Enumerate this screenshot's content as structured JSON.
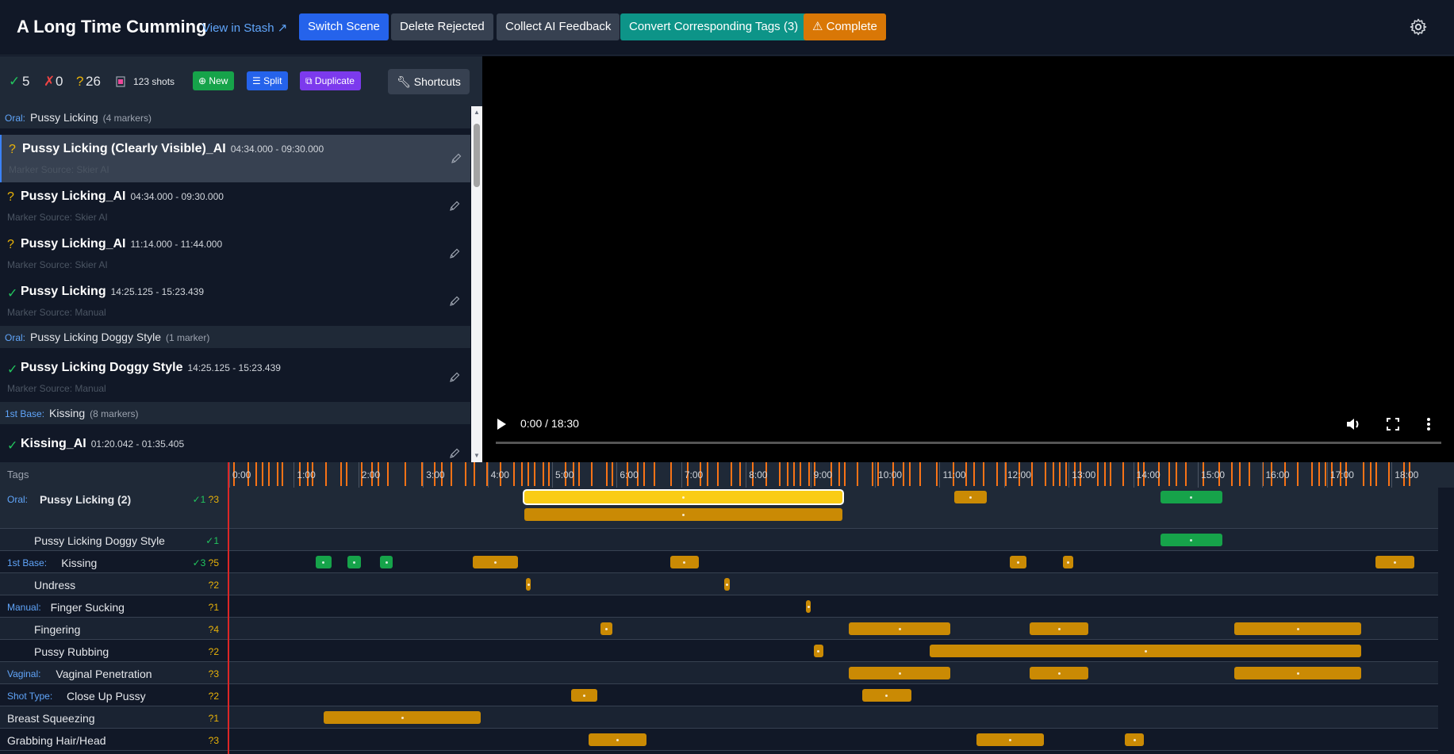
{
  "header": {
    "title": "A Long Time Cumming",
    "view_link": "View in Stash ↗",
    "buttons": {
      "switch_scene": "Switch Scene",
      "delete_rejected": "Delete Rejected",
      "collect_feedback": "Collect AI Feedback",
      "convert_tags": "Convert Corresponding Tags (3)",
      "complete": "Complete"
    },
    "colors": {
      "primary": "#2563eb",
      "secondary": "#374151",
      "teal": "#0d9488",
      "warning": "#d97706"
    }
  },
  "stats": {
    "confirmed_icon": "✓",
    "confirmed": "5",
    "rejected_icon": "✗",
    "rejected": "0",
    "pending_icon": "?",
    "pending": "26",
    "shots": "123 shots",
    "new_label": "New",
    "split_label": "Split",
    "duplicate_label": "Duplicate",
    "shortcuts_label": "Shortcuts"
  },
  "marker_list": {
    "groups": [
      {
        "category": "Oral:",
        "tag": "Pussy Licking",
        "count": "(4 markers)"
      },
      {
        "category": "Oral:",
        "tag": "Pussy Licking Doggy Style",
        "count": "(1 marker)"
      },
      {
        "category": "1st Base:",
        "tag": "Kissing",
        "count": "(8 markers)"
      }
    ],
    "markers": [
      {
        "status": "?",
        "status_type": "pending",
        "name": "Pussy Licking (Clearly Visible)_AI",
        "time": "04:34.000 - 09:30.000",
        "source": "Marker Source: Skier AI",
        "selected": true
      },
      {
        "status": "?",
        "status_type": "pending",
        "name": "Pussy Licking_AI",
        "time": "04:34.000 - 09:30.000",
        "source": "Marker Source: Skier AI"
      },
      {
        "status": "?",
        "status_type": "pending",
        "name": "Pussy Licking_AI",
        "time": "11:14.000 - 11:44.000",
        "source": "Marker Source: Skier AI"
      },
      {
        "status": "✓",
        "status_type": "confirmed",
        "name": "Pussy Licking",
        "time": "14:25.125 - 15:23.439",
        "source": "Marker Source: Manual"
      },
      {
        "status": "✓",
        "status_type": "confirmed",
        "name": "Pussy Licking Doggy Style",
        "time": "14:25.125 - 15:23.439",
        "source": "Marker Source: Manual"
      },
      {
        "status": "✓",
        "status_type": "confirmed",
        "name": "Kissing_AI",
        "time": "01:20.042 - 01:35.405",
        "source": ""
      }
    ]
  },
  "video": {
    "time": "0:00 / 18:30",
    "duration_seconds": 1110
  },
  "timeline": {
    "tags_label": "Tags",
    "ticks": [
      "0:00",
      "1:00",
      "2:00",
      "3:00",
      "4:00",
      "5:00",
      "6:00",
      "7:00",
      "8:00",
      "9:00",
      "10:00",
      "11:00",
      "12:00",
      "13:00",
      "14:00",
      "15:00",
      "16:00",
      "17:00",
      "18:00"
    ],
    "rows": [
      {
        "category": "Oral:",
        "tag": "Pussy Licking (2)",
        "bold": true,
        "confirmed": "✓1",
        "pending": "?3",
        "tall": true,
        "bars": [
          {
            "start": 274,
            "end": 570,
            "status": "selected",
            "lane": 0
          },
          {
            "start": 274,
            "end": 570,
            "status": "pending",
            "lane": 1
          },
          {
            "start": 674,
            "end": 704,
            "status": "pending",
            "lane": 0
          },
          {
            "start": 865,
            "end": 923,
            "status": "confirmed",
            "lane": 0
          }
        ]
      },
      {
        "category": "",
        "tag": "Pussy Licking Doggy Style",
        "confirmed": "✓1",
        "pending": "",
        "bars": [
          {
            "start": 865,
            "end": 923,
            "status": "confirmed"
          }
        ]
      },
      {
        "category": "1st Base:",
        "tag": "Kissing",
        "confirmed": "✓3",
        "pending": "?5",
        "bars": [
          {
            "start": 80,
            "end": 95,
            "status": "confirmed"
          },
          {
            "start": 110,
            "end": 122,
            "status": "confirmed"
          },
          {
            "start": 140,
            "end": 152,
            "status": "confirmed"
          },
          {
            "start": 226,
            "end": 268,
            "status": "pending"
          },
          {
            "start": 410,
            "end": 436,
            "status": "pending"
          },
          {
            "start": 725,
            "end": 741,
            "status": "pending"
          },
          {
            "start": 775,
            "end": 784,
            "status": "pending"
          },
          {
            "start": 1065,
            "end": 1101,
            "status": "pending"
          }
        ]
      },
      {
        "category": "",
        "tag": "Undress",
        "confirmed": "",
        "pending": "?2",
        "bars": [
          {
            "start": 276,
            "end": 280,
            "status": "pending"
          },
          {
            "start": 460,
            "end": 465,
            "status": "pending"
          }
        ]
      },
      {
        "category": "Manual:",
        "tag": "Finger Sucking",
        "confirmed": "",
        "pending": "?1",
        "bars": [
          {
            "start": 536,
            "end": 540,
            "status": "pending"
          }
        ]
      },
      {
        "category": "",
        "tag": "Fingering",
        "confirmed": "",
        "pending": "?4",
        "bars": [
          {
            "start": 345,
            "end": 356,
            "status": "pending"
          },
          {
            "start": 576,
            "end": 670,
            "status": "pending"
          },
          {
            "start": 744,
            "end": 798,
            "status": "pending"
          },
          {
            "start": 934,
            "end": 1052,
            "status": "pending"
          }
        ]
      },
      {
        "category": "",
        "tag": "Pussy Rubbing",
        "confirmed": "",
        "pending": "?2",
        "bars": [
          {
            "start": 543,
            "end": 552,
            "status": "pending"
          },
          {
            "start": 651,
            "end": 1052,
            "status": "pending"
          }
        ]
      },
      {
        "category": "Vaginal:",
        "tag": "Vaginal Penetration",
        "confirmed": "",
        "pending": "?3",
        "bars": [
          {
            "start": 576,
            "end": 670,
            "status": "pending"
          },
          {
            "start": 744,
            "end": 798,
            "status": "pending"
          },
          {
            "start": 934,
            "end": 1052,
            "status": "pending"
          }
        ]
      },
      {
        "category": "Shot Type:",
        "tag": "Close Up Pussy",
        "confirmed": "",
        "pending": "?2",
        "bars": [
          {
            "start": 318,
            "end": 342,
            "status": "pending"
          },
          {
            "start": 588,
            "end": 634,
            "status": "pending"
          }
        ]
      },
      {
        "category": "",
        "tag": "Breast Squeezing",
        "confirmed": "",
        "pending": "?1",
        "bars": [
          {
            "start": 88,
            "end": 234,
            "status": "pending"
          }
        ]
      },
      {
        "category": "",
        "tag": "Grabbing Hair/Head",
        "confirmed": "",
        "pending": "?3",
        "bars": [
          {
            "start": 334,
            "end": 388,
            "status": "pending"
          },
          {
            "start": 694,
            "end": 757,
            "status": "pending"
          },
          {
            "start": 832,
            "end": 850,
            "status": "pending"
          }
        ]
      }
    ],
    "colors": {
      "confirmed": "#16a34a",
      "pending": "#ca8a04",
      "selected": "#facc15",
      "cuts": "#f97316",
      "playhead": "#dc2626"
    }
  }
}
